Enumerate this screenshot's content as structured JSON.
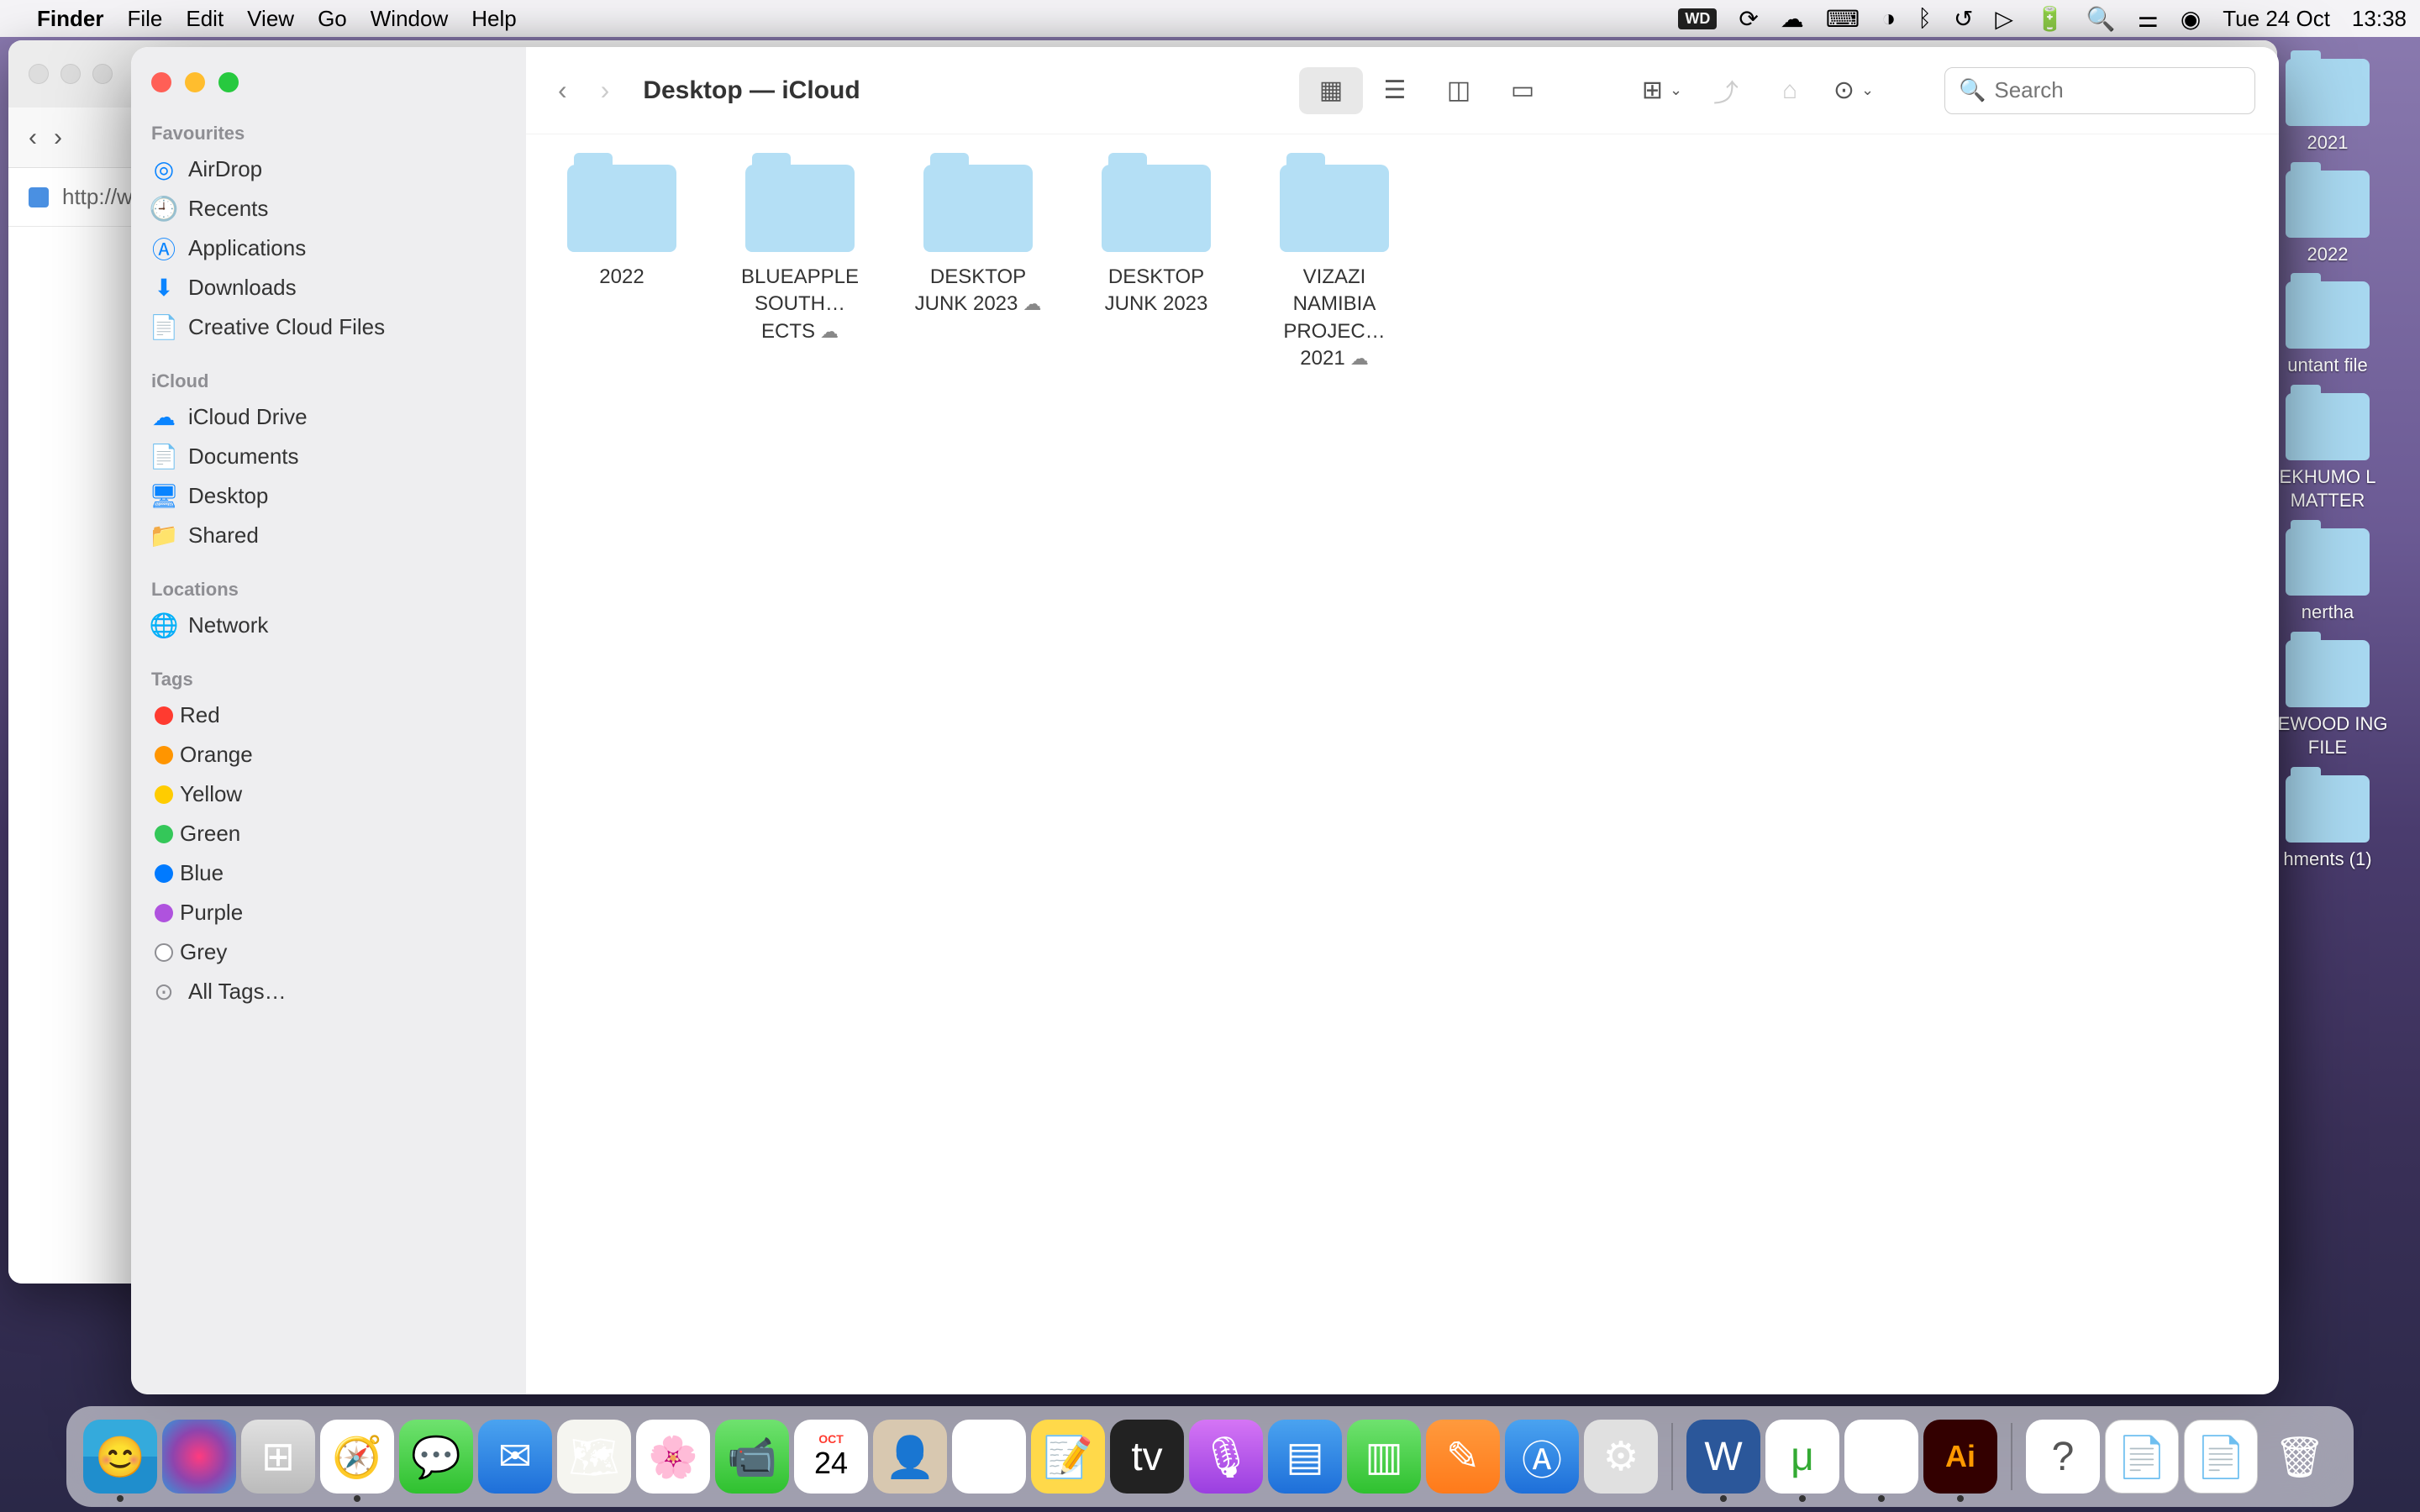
{
  "menubar": {
    "app": "Finder",
    "items": [
      "File",
      "Edit",
      "View",
      "Go",
      "Window",
      "Help"
    ],
    "date": "Tue 24 Oct",
    "time": "13:38"
  },
  "bg_browser": {
    "url": "http://w"
  },
  "desktop_folders": [
    {
      "label": "2021"
    },
    {
      "label": "2022"
    },
    {
      "label": "untant file"
    },
    {
      "label": "EKHUMO L MATTER"
    },
    {
      "label": "nertha"
    },
    {
      "label": "LEWOOD ING FILE"
    },
    {
      "label": "hments (1)"
    }
  ],
  "finder": {
    "title": "Desktop — iCloud",
    "search_placeholder": "Search",
    "sidebar": {
      "favourites_title": "Favourites",
      "favourites": [
        {
          "icon": "airdrop",
          "label": "AirDrop"
        },
        {
          "icon": "recents",
          "label": "Recents"
        },
        {
          "icon": "apps",
          "label": "Applications"
        },
        {
          "icon": "downloads",
          "label": "Downloads"
        },
        {
          "icon": "doc",
          "label": "Creative Cloud Files"
        }
      ],
      "icloud_title": "iCloud",
      "icloud": [
        {
          "icon": "cloud",
          "label": "iCloud Drive"
        },
        {
          "icon": "doc",
          "label": "Documents"
        },
        {
          "icon": "desktop",
          "label": "Desktop"
        },
        {
          "icon": "folder",
          "label": "Shared"
        }
      ],
      "locations_title": "Locations",
      "locations": [
        {
          "icon": "globe",
          "label": "Network"
        }
      ],
      "tags_title": "Tags",
      "tags": [
        {
          "color": "#ff3b30",
          "label": "Red"
        },
        {
          "color": "#ff9500",
          "label": "Orange"
        },
        {
          "color": "#ffcc00",
          "label": "Yellow"
        },
        {
          "color": "#34c759",
          "label": "Green"
        },
        {
          "color": "#007aff",
          "label": "Blue"
        },
        {
          "color": "#af52de",
          "label": "Purple"
        },
        {
          "color": "#8e8e93",
          "label": "Grey"
        }
      ],
      "all_tags": "All Tags…"
    },
    "files": [
      {
        "name": "2022",
        "cloud": false
      },
      {
        "name": "BLUEAPPLE SOUTH…ECTS",
        "cloud": true
      },
      {
        "name": "DESKTOP JUNK 2023",
        "cloud": true
      },
      {
        "name": "DESKTOP JUNK 2023",
        "cloud": false
      },
      {
        "name": "VIZAZI NAMIBIA PROJEC…2021",
        "cloud": true
      }
    ]
  },
  "dock": {
    "cal_day": "24",
    "cal_month": "OCT"
  }
}
